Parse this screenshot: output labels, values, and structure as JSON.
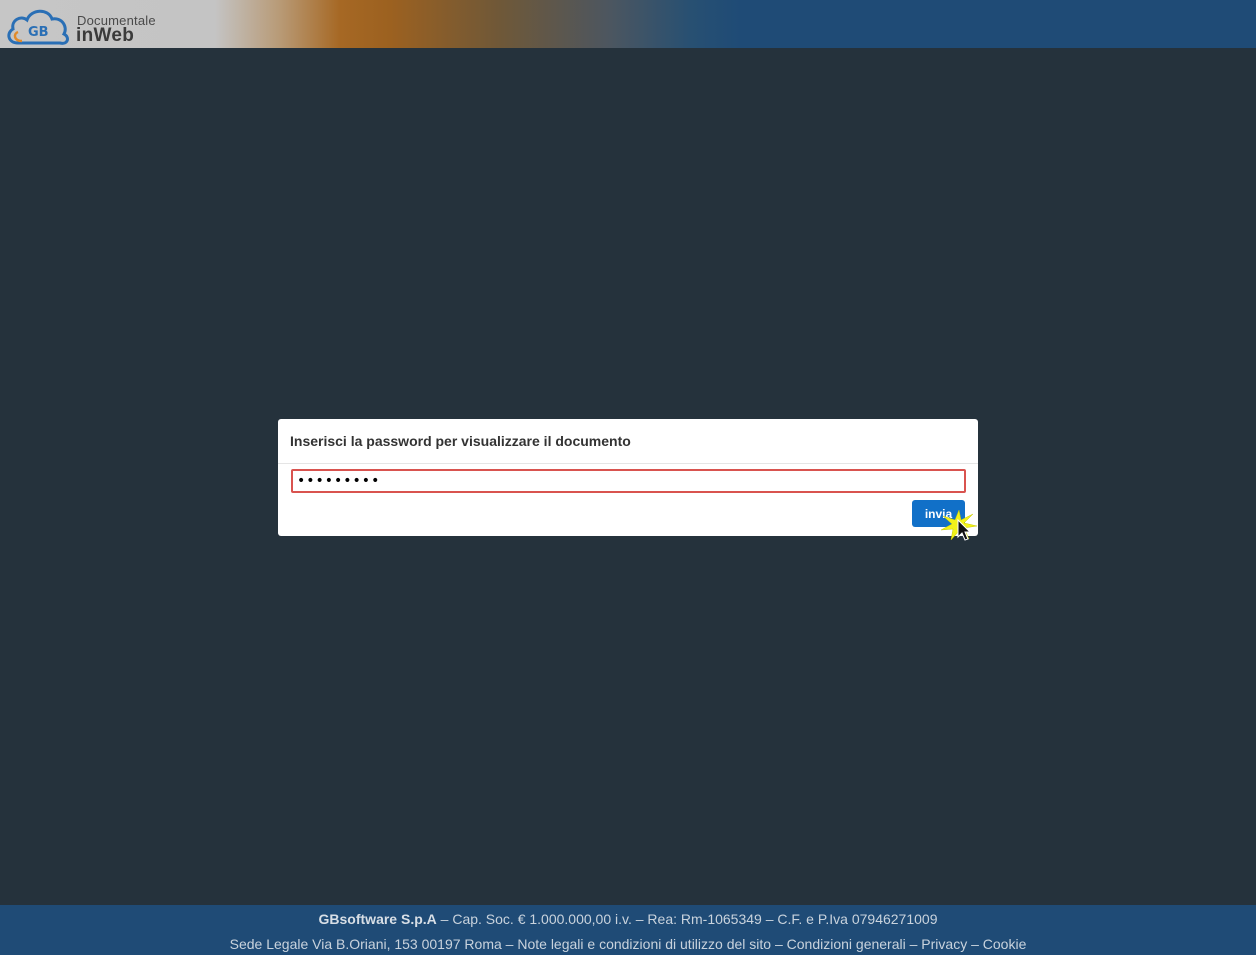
{
  "header": {
    "logo_badge": "GB",
    "logo_top": "Documentale",
    "logo_bottom": "inWeb",
    "colors": {
      "orange": "#a66824",
      "blue": "#1f4b76"
    }
  },
  "dialog": {
    "title": "Inserisci la password per visualizzare il documento",
    "password_value": "•••••••••",
    "submit_label": "invia",
    "colors": {
      "button": "#1170c8",
      "error_border": "#d9534f"
    }
  },
  "footer": {
    "company": "GBsoftware S.p.A",
    "line1_rest": " – Cap. Soc. € 1.000.000,00 i.v. – Rea: Rm-1065349 – C.F. e P.Iva 07946271009",
    "address": "Sede Legale Via B.Oriani, 153 00197 Roma",
    "sep": " – ",
    "link_legal": "Note legali e condizioni di utilizzo del sito",
    "link_conditions": "Condizioni generali",
    "link_privacy": "Privacy",
    "link_cookie": "Cookie"
  },
  "icons": {
    "logo": "cloud-logo-icon",
    "pointer": "mouse-pointer-icon"
  },
  "theme": {
    "background": "#25323c"
  }
}
